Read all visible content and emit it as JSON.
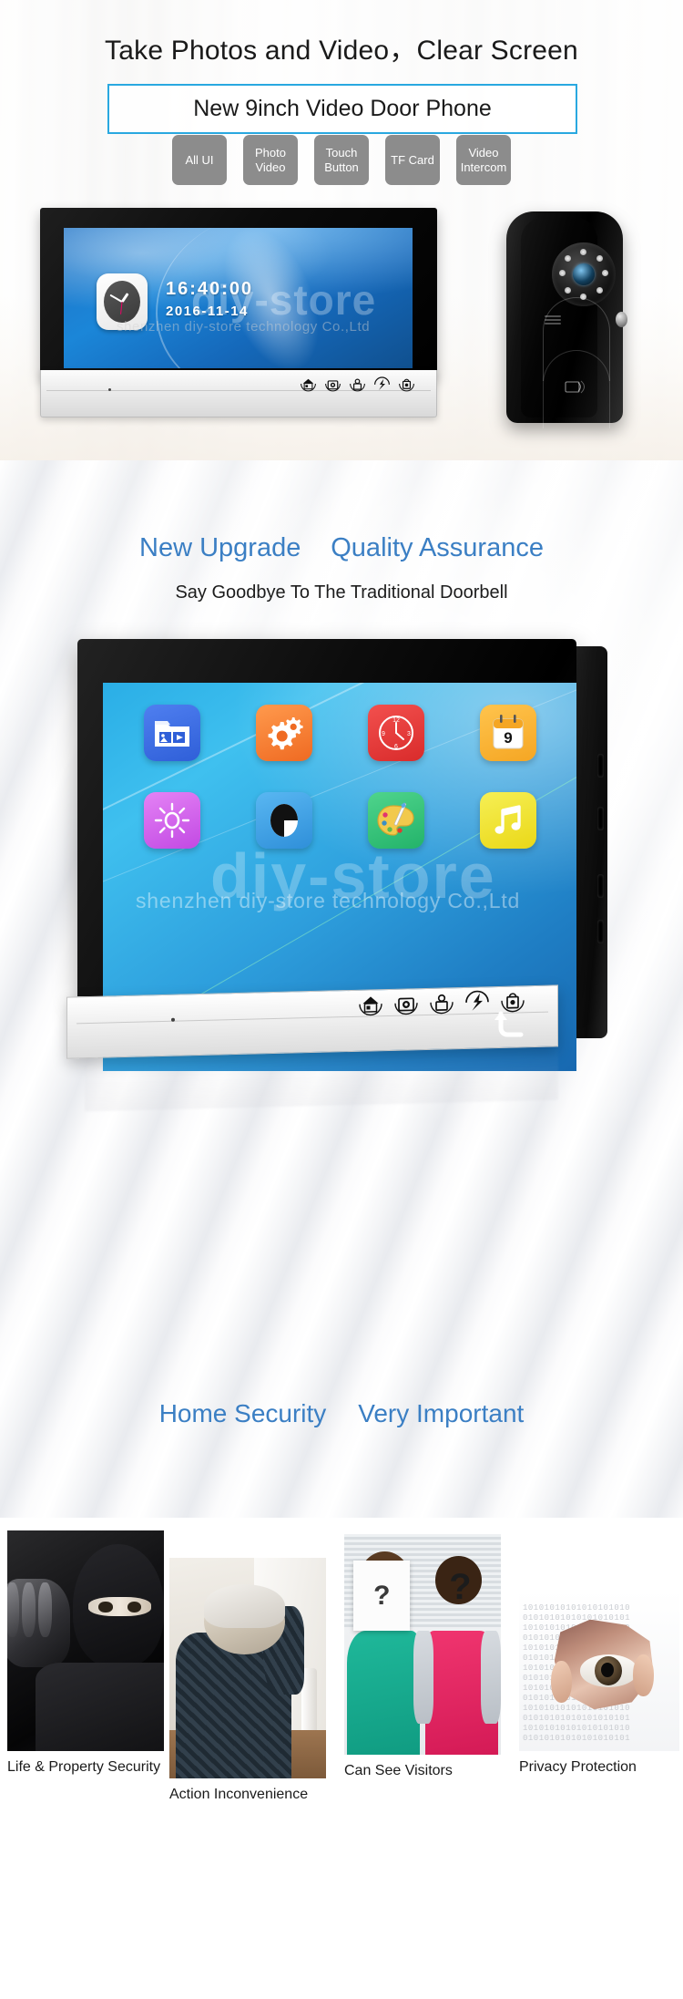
{
  "hero": {
    "title": "Take Photos and Video，Clear Screen",
    "subtitle": "New 9inch Video Door Phone",
    "tags": [
      {
        "line1": "All UI",
        "line2": ""
      },
      {
        "line1": "Photo",
        "line2": "Video"
      },
      {
        "line1": "Touch",
        "line2": "Button"
      },
      {
        "line1": "TF Card",
        "line2": ""
      },
      {
        "line1": "Video",
        "line2": "Intercom"
      }
    ],
    "monitor": {
      "time": "16:40:00",
      "date": "2016-11-14",
      "touch_buttons": [
        "home-icon",
        "camera-icon",
        "unlock-person-icon",
        "talk-icon",
        "monitor-lock-icon"
      ]
    },
    "watermark": "diy-store",
    "watermark_sub": "shenzhen diy-store technology Co.,Ltd"
  },
  "section_two": {
    "heading_left": "New Upgrade",
    "heading_right": "Quality Assurance",
    "subheading": "Say Goodbye To The Traditional Doorbell",
    "bottom_left": "Home Security",
    "bottom_right": "Very Important",
    "watermark": "diy-store",
    "watermark_sub": "shenzhen diy-store technology Co.,Ltd",
    "apps": [
      {
        "name": "photo-video-icon",
        "color": "#3f6fe6"
      },
      {
        "name": "settings-gear-icon",
        "color": "#ef6a22"
      },
      {
        "name": "clock-icon",
        "color": "#d92b2b"
      },
      {
        "name": "calendar-icon",
        "color": "#f5a623",
        "value": "9"
      },
      {
        "name": "brightness-icon",
        "color": "#c249e3"
      },
      {
        "name": "contrast-icon",
        "color": "#2f8fd9"
      },
      {
        "name": "color-palette-icon",
        "color": "#23b36a"
      },
      {
        "name": "music-note-icon",
        "color": "#ead817"
      }
    ],
    "back_button": "back-arrow-icon",
    "touch_buttons": [
      "home-icon",
      "camera-icon",
      "unlock-person-icon",
      "talk-icon",
      "monitor-lock-icon"
    ]
  },
  "features": [
    {
      "caption": "Life & Property Security",
      "image": "burglar-photo"
    },
    {
      "caption": "Action Inconvenience",
      "image": "elderly-person-photo"
    },
    {
      "caption": "Can See Visitors",
      "image": "visitors-question-mark-photo"
    },
    {
      "caption": "Privacy Protection",
      "image": "eye-through-paper-photo"
    }
  ],
  "colors": {
    "accent_blue": "#29a8e0",
    "heading_blue": "#3b7fc4",
    "tag_gray": "#8c8c8c"
  }
}
